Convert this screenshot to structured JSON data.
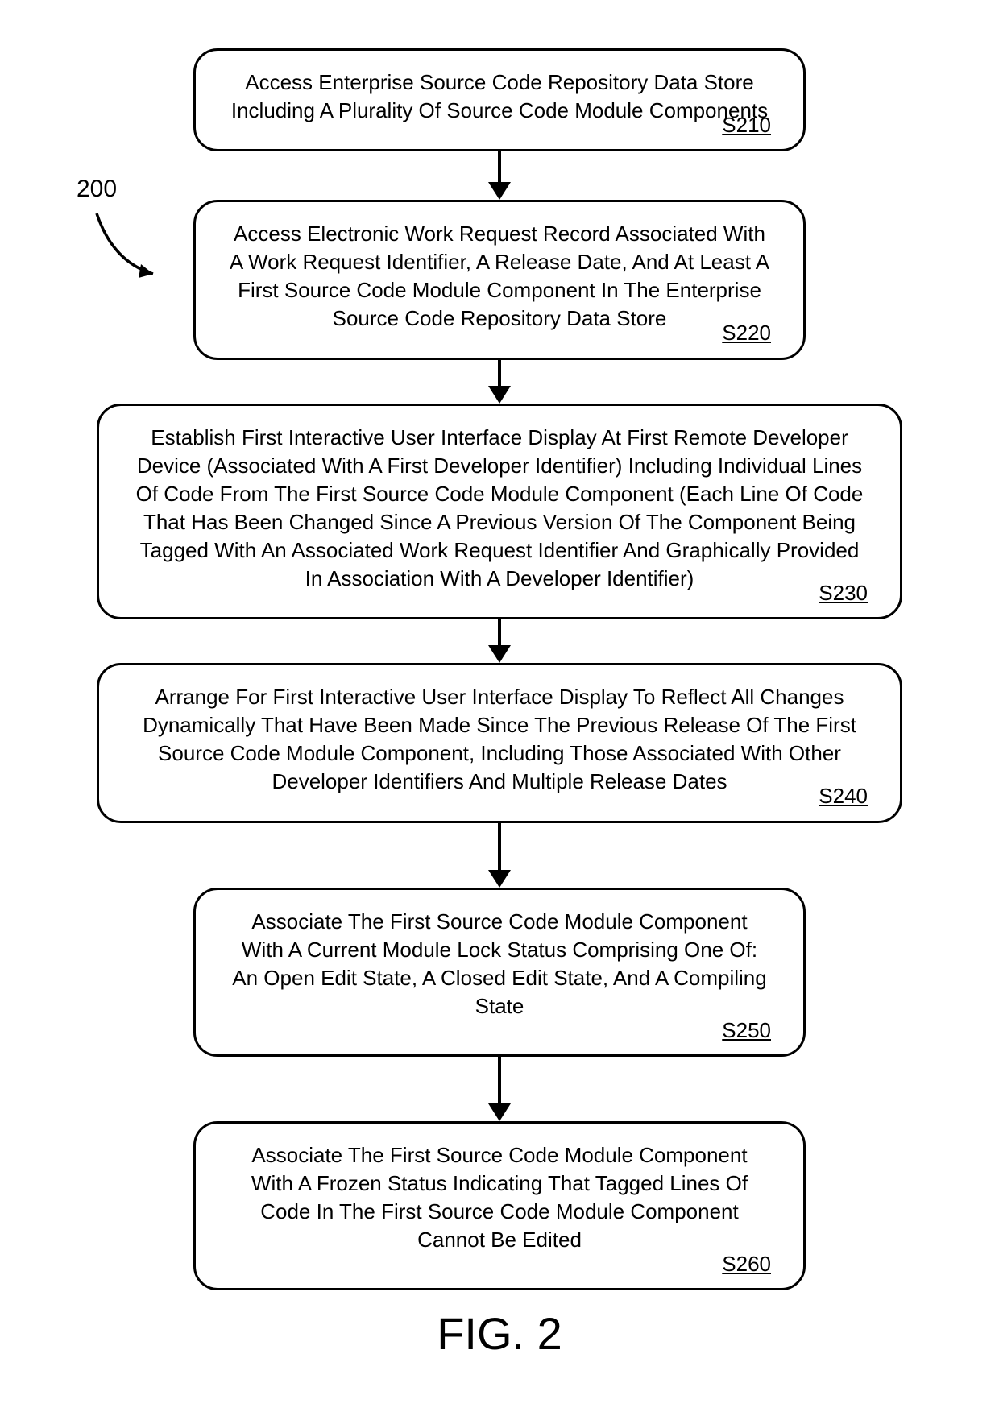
{
  "refLabel": "200",
  "figure": "FIG. 2",
  "steps": [
    {
      "id": "S210",
      "width": "narrow",
      "text": "Access Enterprise Source Code Repository Data Store Including A Plurality Of Source Code Module Components"
    },
    {
      "id": "S220",
      "width": "narrow",
      "text": "Access Electronic Work Request Record Associated With A Work Request Identifier, A Release Date, And At Least A First Source Code Module Component In The Enterprise Source Code Repository Data Store"
    },
    {
      "id": "S230",
      "width": "wide",
      "text": "Establish First Interactive User Interface Display At First Remote Developer Device (Associated With A First Developer Identifier) Including Individual Lines Of Code From The First Source Code Module Component (Each Line Of Code That Has Been Changed Since A Previous Version Of The Component Being Tagged With An Associated Work Request Identifier And Graphically Provided In Association With A Developer Identifier)"
    },
    {
      "id": "S240",
      "width": "wide",
      "text": "Arrange For First Interactive User Interface Display To Reflect All Changes Dynamically That Have Been Made Since The Previous Release Of The First Source Code Module Component, Including Those Associated With Other Developer Identifiers And Multiple Release Dates"
    },
    {
      "id": "S250",
      "width": "narrow",
      "text": "Associate The First Source Code Module Component With A Current Module Lock Status Comprising One Of: An Open Edit State, A Closed Edit State, And A Compiling State"
    },
    {
      "id": "S260",
      "width": "narrow",
      "text": "Associate The First Source Code Module Component With A Frozen Status Indicating That Tagged Lines Of Code In The First Source Code Module Component Cannot Be Edited"
    }
  ]
}
